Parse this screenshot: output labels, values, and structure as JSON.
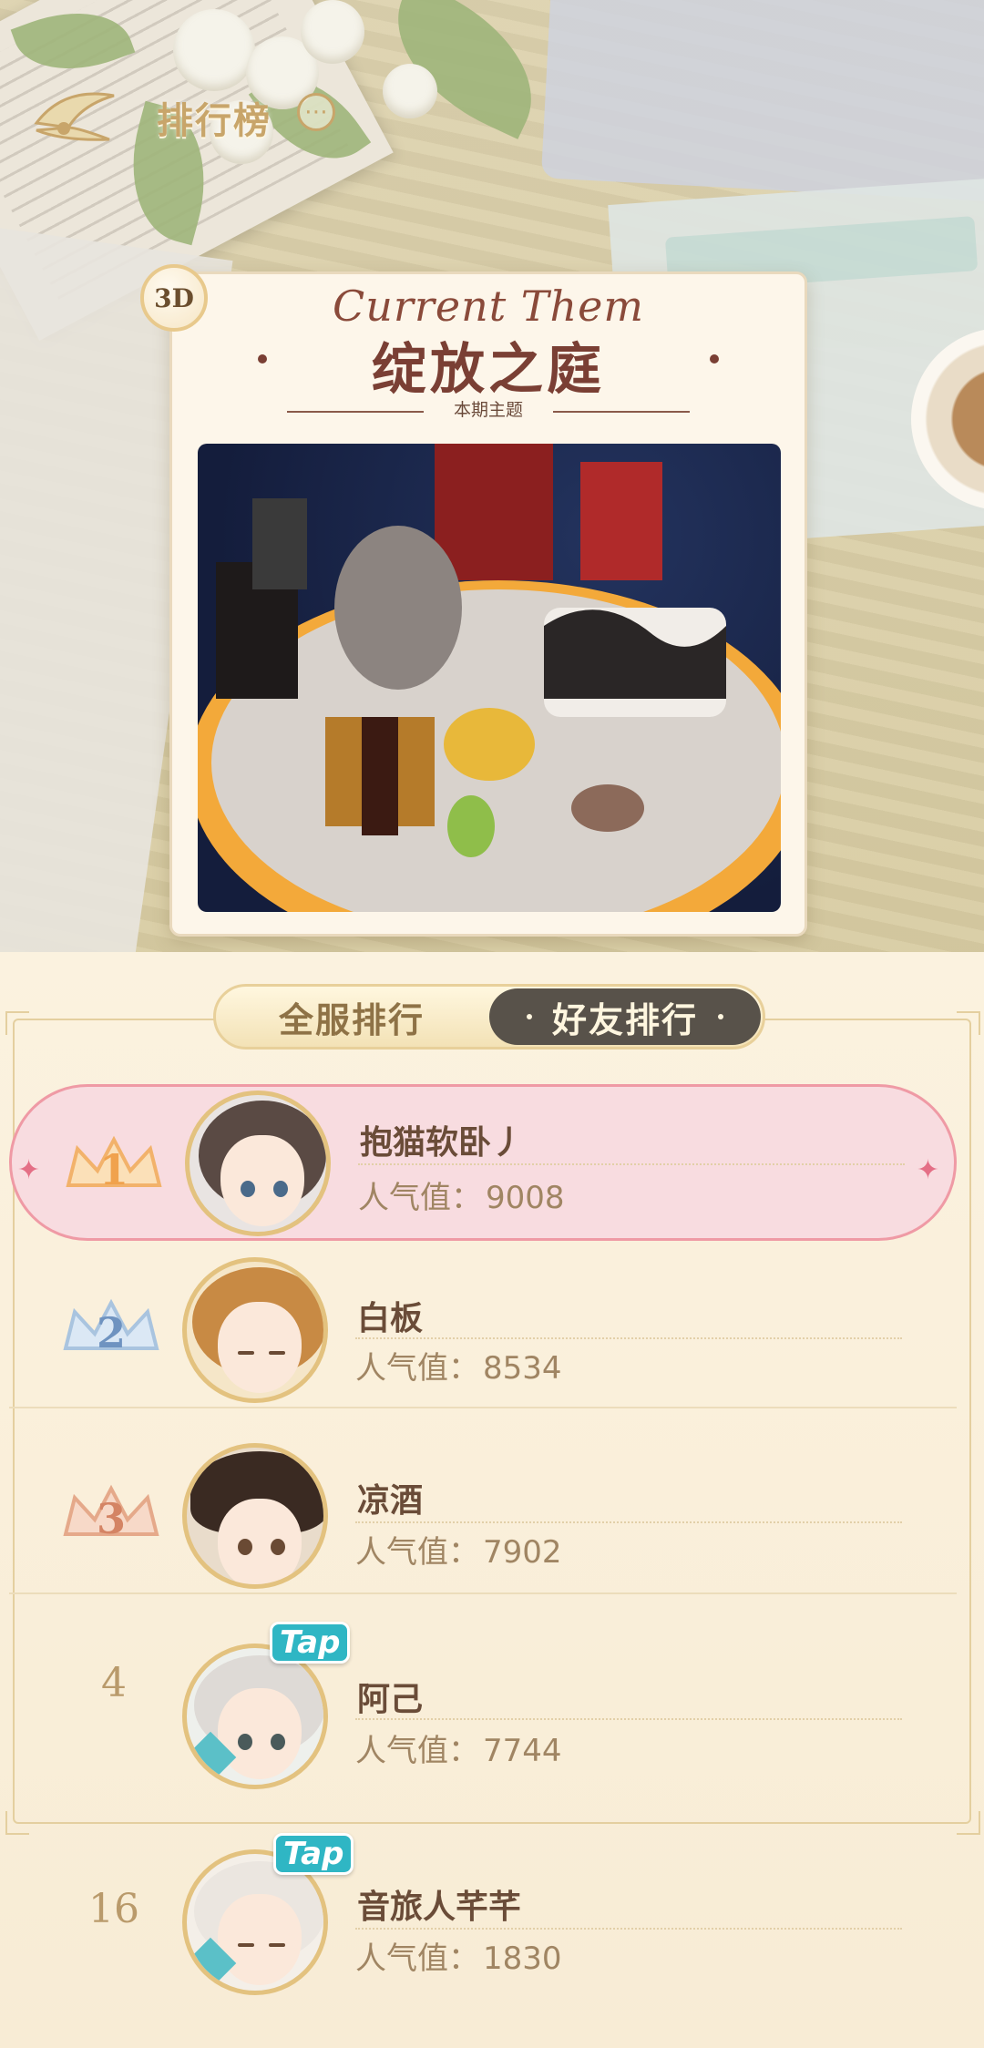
{
  "header": {
    "title": "排行榜",
    "more_icon": "ellipsis-icon",
    "logo_icon": "winged-logo-icon"
  },
  "theme": {
    "badge": "3D",
    "script_title": "Current Them",
    "name": "绽放之庭",
    "subtitle": "本期主题"
  },
  "tabs": {
    "all_label": "全服排行",
    "friends_label": "好友排行",
    "active": "friends"
  },
  "ranking": {
    "pop_label": "人气值：",
    "rows": [
      {
        "rank": "1",
        "name": "抱猫软卧丿",
        "popularity": "9008",
        "crown": "gold",
        "tap": ""
      },
      {
        "rank": "2",
        "name": "白板",
        "popularity": "8534",
        "crown": "silver",
        "tap": ""
      },
      {
        "rank": "3",
        "name": "凉酒",
        "popularity": "7902",
        "crown": "bronze",
        "tap": ""
      },
      {
        "rank": "4",
        "name": "阿己",
        "popularity": "7744",
        "crown": "",
        "tap": "Tap"
      },
      {
        "rank": "16",
        "name": "音旅人芊芊",
        "popularity": "1830",
        "crown": "",
        "tap": "Tap"
      }
    ]
  },
  "colors": {
    "accent": "#c8a56a",
    "highlight": "#f8dce0",
    "highlight_border": "#ef9aa5",
    "tap": "#2fb6c4",
    "tab_active": "#58524a"
  }
}
